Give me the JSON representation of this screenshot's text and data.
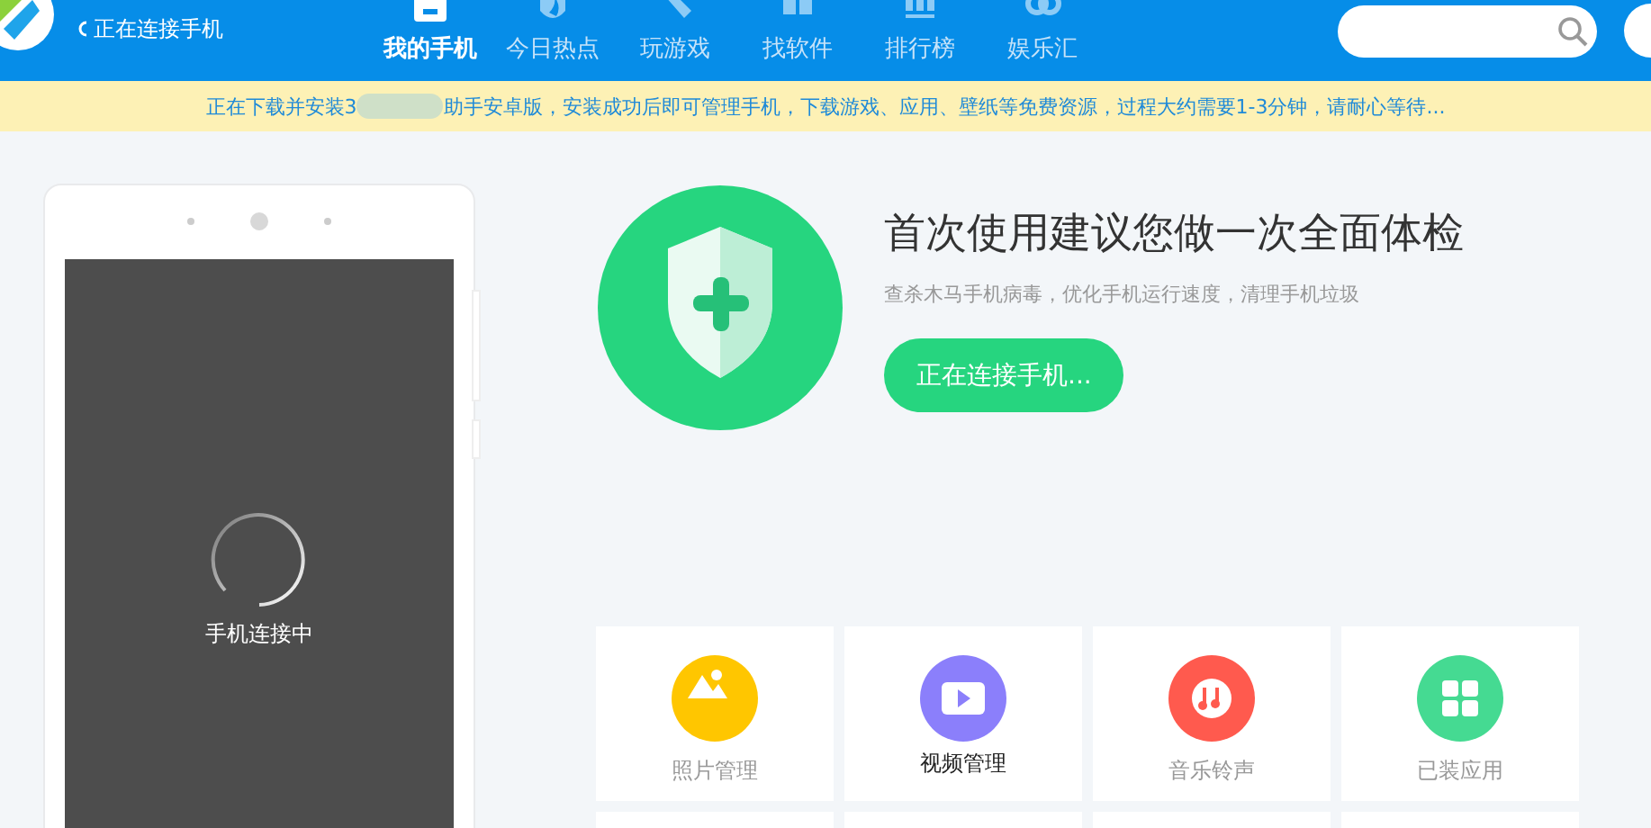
{
  "header": {
    "status": "正在连接手机",
    "nav": [
      {
        "label": "我的手机",
        "selected": true,
        "kind": "phone"
      },
      {
        "label": "今日热点",
        "selected": false,
        "kind": "flame"
      },
      {
        "label": "玩游戏",
        "selected": false,
        "kind": "game"
      },
      {
        "label": "找软件",
        "selected": false,
        "kind": "grid"
      },
      {
        "label": "排行榜",
        "selected": false,
        "kind": "bars"
      },
      {
        "label": "娱乐汇",
        "selected": false,
        "kind": "fun"
      }
    ]
  },
  "notice": {
    "before": "正在下载并安装3",
    "after": "助手安卓版，安装成功后即可管理手机，下载游戏、应用、壁纸等免费资源，过程大约需要1-3分钟，请耐心等待..."
  },
  "phone": {
    "status": "手机连接中"
  },
  "checkup": {
    "title": "首次使用建议您做一次全面体检",
    "subtitle": "查杀木马手机病毒，优化手机运行速度，清理手机垃圾",
    "button": "正在连接手机..."
  },
  "tiles": [
    {
      "label": "照片管理",
      "kind": "photo",
      "color": "#ffc600",
      "highlighted": false
    },
    {
      "label": "视频管理",
      "kind": "video",
      "color": "#8b7ffb",
      "highlighted": true
    },
    {
      "label": "音乐铃声",
      "kind": "music",
      "color": "#ff5a4e",
      "highlighted": false
    },
    {
      "label": "已装应用",
      "kind": "apps",
      "color": "#45da92",
      "highlighted": false
    }
  ]
}
